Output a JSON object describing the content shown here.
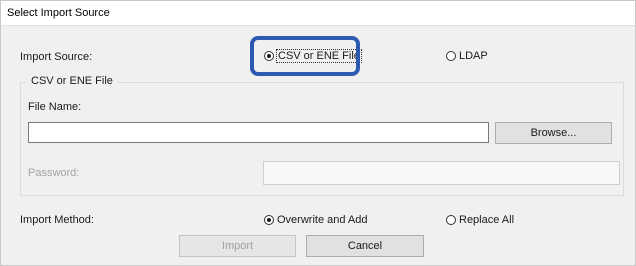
{
  "dialog": {
    "title": "Select Import Source"
  },
  "import_source": {
    "label": "Import Source:",
    "options": [
      {
        "label": "CSV or ENE File",
        "selected": true
      },
      {
        "label": "LDAP",
        "selected": false
      }
    ]
  },
  "file_group": {
    "title": "CSV or ENE File",
    "file_name_label": "File Name:",
    "file_name_value": "",
    "browse_label": "Browse...",
    "password_label": "Password:",
    "password_value": ""
  },
  "import_method": {
    "label": "Import Method:",
    "options": [
      {
        "label": "Overwrite and Add",
        "selected": true
      },
      {
        "label": "Replace All",
        "selected": false
      }
    ]
  },
  "buttons": {
    "import_label": "Import",
    "cancel_label": "Cancel"
  },
  "colors": {
    "highlight": "#2c5ab0",
    "dialog_bg": "#f0f0f0"
  }
}
